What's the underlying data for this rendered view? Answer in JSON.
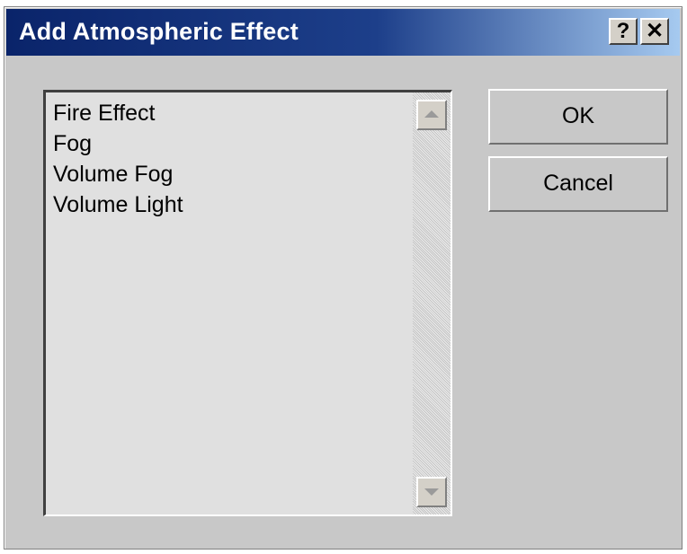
{
  "window": {
    "title": "Add Atmospheric Effect",
    "help_label": "?",
    "close_label": "✕"
  },
  "list": {
    "items": [
      {
        "label": "Fire Effect"
      },
      {
        "label": "Fog"
      },
      {
        "label": "Volume Fog"
      },
      {
        "label": "Volume Light"
      }
    ]
  },
  "buttons": {
    "ok_label": "OK",
    "cancel_label": "Cancel"
  },
  "colors": {
    "titlebar_start": "#0a246a",
    "titlebar_end": "#a6caf0",
    "dialog_bg": "#c8c8c8",
    "list_bg": "#e0e0e0"
  }
}
